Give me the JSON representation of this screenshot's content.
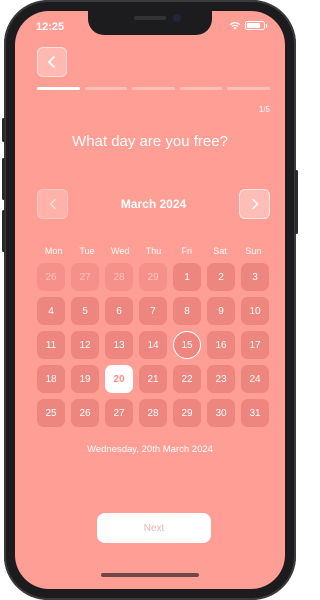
{
  "status": {
    "time": "12:25"
  },
  "header": {
    "back_icon": "chevron-left-icon",
    "progress": {
      "current": 1,
      "total": 5
    },
    "step_label": "1/5"
  },
  "question": "What day are you free?",
  "calendar": {
    "month_label": "March 2024",
    "prev_icon": "chevron-left-icon",
    "next_icon": "chevron-right-icon",
    "weekdays": [
      "Mon",
      "Tue",
      "Wed",
      "Thu",
      "Fri",
      "Sat",
      "Sun"
    ],
    "days": [
      {
        "label": "26",
        "muted": true
      },
      {
        "label": "27",
        "muted": true
      },
      {
        "label": "28",
        "muted": true
      },
      {
        "label": "29",
        "muted": true
      },
      {
        "label": "1"
      },
      {
        "label": "2"
      },
      {
        "label": "3"
      },
      {
        "label": "4"
      },
      {
        "label": "5"
      },
      {
        "label": "6"
      },
      {
        "label": "7"
      },
      {
        "label": "8"
      },
      {
        "label": "9"
      },
      {
        "label": "10"
      },
      {
        "label": "11"
      },
      {
        "label": "12"
      },
      {
        "label": "13"
      },
      {
        "label": "14"
      },
      {
        "label": "15",
        "today": true
      },
      {
        "label": "16"
      },
      {
        "label": "17"
      },
      {
        "label": "18"
      },
      {
        "label": "19"
      },
      {
        "label": "20",
        "selected": true
      },
      {
        "label": "21"
      },
      {
        "label": "22"
      },
      {
        "label": "23"
      },
      {
        "label": "24"
      },
      {
        "label": "25"
      },
      {
        "label": "26"
      },
      {
        "label": "27"
      },
      {
        "label": "28"
      },
      {
        "label": "29"
      },
      {
        "label": "30"
      },
      {
        "label": "31"
      }
    ],
    "selected_date_text": "Wednesday, 20th March 2024"
  },
  "footer": {
    "next_label": "Next"
  },
  "colors": {
    "background": "#ff9e95",
    "accent": "#ffffff",
    "selected_text": "#ff8f86"
  }
}
